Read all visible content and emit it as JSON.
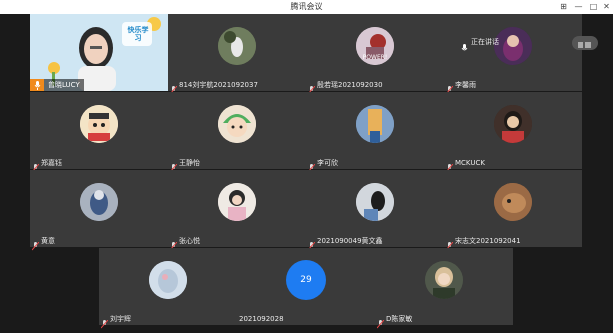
{
  "window": {
    "title": "腾讯会议"
  },
  "window_controls": {
    "pin": "⊞",
    "minimize": "—",
    "maximize": "□",
    "close": "✕"
  },
  "self_view": {
    "name": "曾晓LUCY",
    "badge_text": "快乐学习",
    "mic_color": "#f08a1c"
  },
  "speaking_badge": {
    "label": "正在讲话"
  },
  "participants": [
    {
      "name": "814刘宇航2021092037"
    },
    {
      "name": "殷若瑶2021092030",
      "avatar_caption": "POWER!"
    },
    {
      "name": "李馨雨"
    },
    {
      "name": "郑嘉钰"
    },
    {
      "name": "王静怡"
    },
    {
      "name": "李可欣"
    },
    {
      "name": "MCKUCK"
    },
    {
      "name": "黄意"
    },
    {
      "name": "张心悦"
    },
    {
      "name": "2021090049黄文鑫"
    },
    {
      "name": "宋志文2021092041"
    },
    {
      "name": "刘宇辉"
    },
    {
      "name": "2021092028",
      "count": "29"
    },
    {
      "name": "D陈家敏"
    }
  ],
  "colors": {
    "tile": "#3a3a3a",
    "background": "#1a1a1a",
    "accent": "#1e7cf2"
  }
}
